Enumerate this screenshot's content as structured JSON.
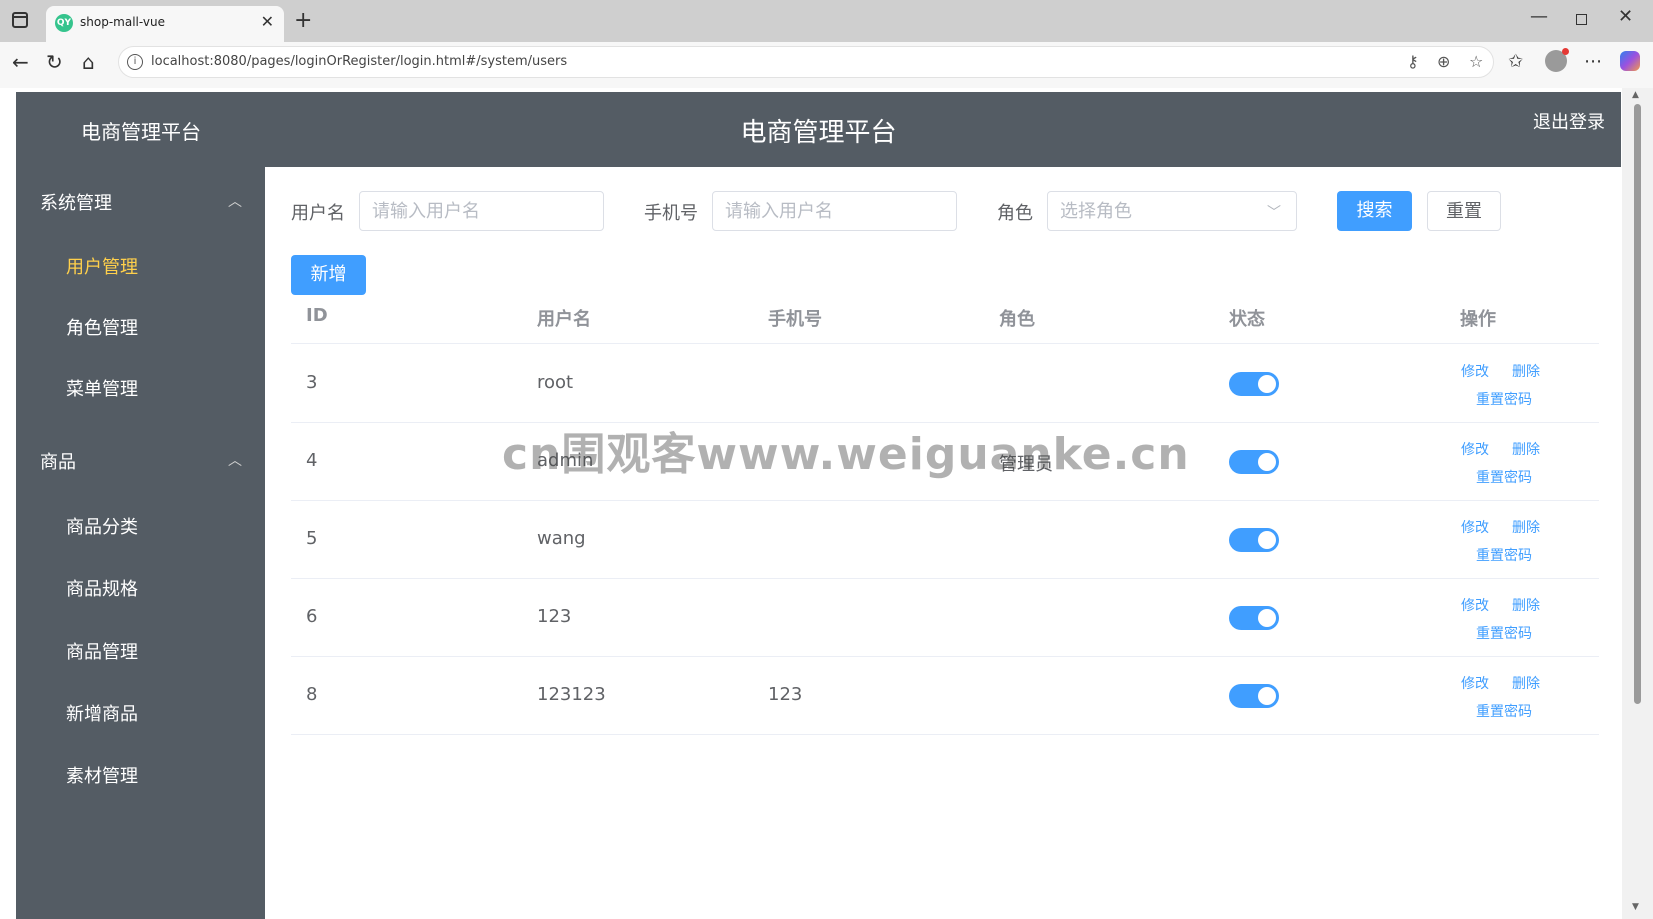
{
  "browser": {
    "tab_title": "shop-mall-vue",
    "tab_favicon": "QY",
    "url": "localhost:8080/pages/loginOrRegister/login.html#/system/users"
  },
  "header": {
    "logo": "电商管理平台",
    "title": "电商管理平台",
    "logout": "退出登录"
  },
  "sidebar": {
    "groups": [
      {
        "label": "系统管理",
        "items": [
          "用户管理",
          "角色管理",
          "菜单管理"
        ]
      },
      {
        "label": "商品",
        "items": [
          "商品分类",
          "商品规格",
          "商品管理",
          "新增商品",
          "素材管理"
        ]
      }
    ],
    "active_item": "用户管理"
  },
  "search": {
    "username_label": "用户名",
    "username_placeholder": "请输入用户名",
    "phone_label": "手机号",
    "phone_placeholder": "请输入用户名",
    "role_label": "角色",
    "role_placeholder": "选择角色",
    "search_button": "搜索",
    "reset_button": "重置"
  },
  "add_button": "新增",
  "table": {
    "columns": [
      "ID",
      "用户名",
      "手机号",
      "角色",
      "状态",
      "操作"
    ],
    "rows": [
      {
        "id": "3",
        "username": "root",
        "phone": "",
        "role": "",
        "enabled": true
      },
      {
        "id": "4",
        "username": "admin",
        "phone": "",
        "role": "管理员",
        "enabled": true
      },
      {
        "id": "5",
        "username": "wang",
        "phone": "",
        "role": "",
        "enabled": true
      },
      {
        "id": "6",
        "username": "123",
        "phone": "",
        "role": "",
        "enabled": true
      },
      {
        "id": "8",
        "username": "123123",
        "phone": "123",
        "role": "",
        "enabled": true
      }
    ],
    "actions": {
      "edit": "修改",
      "delete": "删除",
      "reset_password": "重置密码"
    }
  },
  "watermark": "cn围观客www.weiguanke.cn",
  "colors": {
    "sidebar_bg": "#545c64",
    "active": "#ffd04b",
    "primary": "#409eff"
  }
}
